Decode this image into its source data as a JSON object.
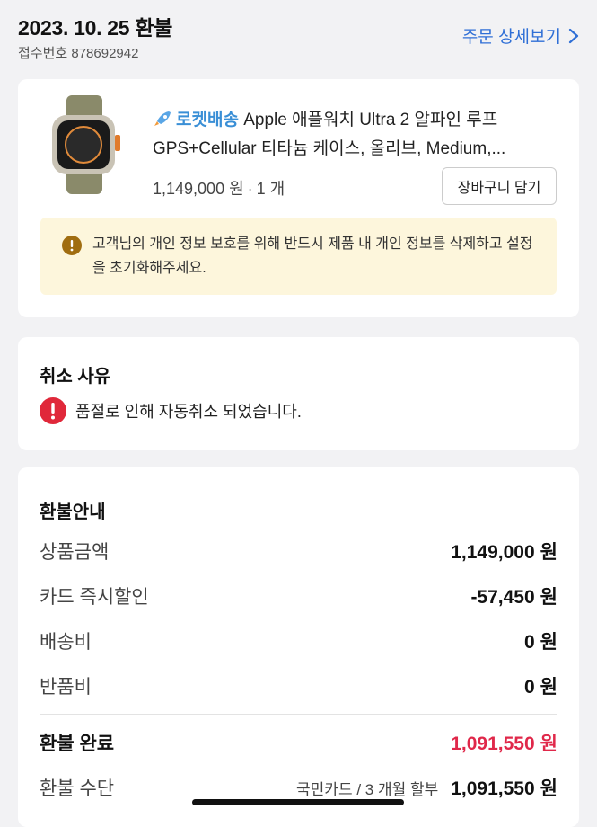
{
  "header": {
    "title": "2023. 10. 25 환불",
    "receipt": "접수번호 878692942",
    "detail_link": "주문 상세보기"
  },
  "product": {
    "rocket_label": "로켓배송",
    "name": "Apple 애플워치 Ultra 2 알파인 루프 GPS+Cellular 티타늄 케이스, 올리브, Medium,...",
    "price": "1,149,000 원",
    "quantity": "1 개",
    "cart_button": "장바구니 담기",
    "notice": "고객님의 개인 정보 보호를 위해 반드시 제품 내 개인 정보를 삭제하고 설정을 초기화해주세요."
  },
  "cancel": {
    "title": "취소 사유",
    "reason": "품절로 인해 자동취소 되었습니다."
  },
  "refund": {
    "title": "환불안내",
    "rows": [
      {
        "label": "상품금액",
        "value": "1,149,000",
        "unit": "원"
      },
      {
        "label": "카드 즉시할인",
        "value": "-57,450",
        "unit": "원"
      },
      {
        "label": "배송비",
        "value": "0",
        "unit": "원"
      },
      {
        "label": "반품비",
        "value": "0",
        "unit": "원"
      }
    ],
    "total": {
      "label": "환불 완료",
      "value": "1,091,550",
      "unit": "원"
    },
    "method": {
      "label": "환불 수단",
      "card": "국민카드 / 3 개월 할부",
      "value": "1,091,550",
      "unit": "원"
    }
  },
  "colors": {
    "accent": "#2f6fd6",
    "total": "#e0284a",
    "rocket": "#3a8fd6",
    "notice_bg": "#fdf6dc"
  },
  "icons": [
    "chevron-right-icon",
    "rocket-icon",
    "warning-icon",
    "alert-icon"
  ]
}
